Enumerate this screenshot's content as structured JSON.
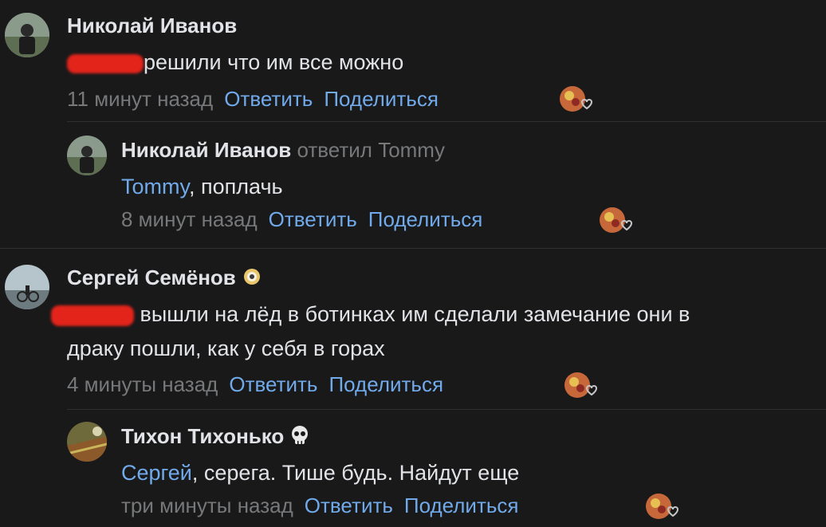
{
  "comments": [
    {
      "author": "Николай Иванов",
      "text": "решили что им все можно",
      "time": "11 минут назад",
      "reply_label": "Ответить",
      "share_label": "Поделиться"
    },
    {
      "author": "Николай Иванов",
      "replied_to": "ответил Tommy",
      "mention": "Tommy",
      "text": ", поплачь",
      "time": "8 минут назад",
      "reply_label": "Ответить",
      "share_label": "Поделиться"
    },
    {
      "author": "Сергей Семёнов",
      "text": "вышли на лёд в ботинках им сделали замечание они в",
      "text_line2": "драку пошли, как у себя в горах",
      "time": "4 минуты назад",
      "reply_label": "Ответить",
      "share_label": "Поделиться"
    },
    {
      "author": "Тихон Тихонько",
      "mention": "Сергей",
      "text": ", серега. Тише будь. Найдут еще",
      "time": "три минуты назад",
      "reply_label": "Ответить",
      "share_label": "Поделиться"
    }
  ],
  "icons": {
    "reaction": "reaction-heart-icon",
    "badge_flower": "flower-badge-icon",
    "badge_skull": "skull-badge-icon"
  },
  "colors": {
    "background": "#19191a",
    "link": "#71aaeb",
    "meta": "#76787a",
    "redaction": "#e3241b"
  }
}
